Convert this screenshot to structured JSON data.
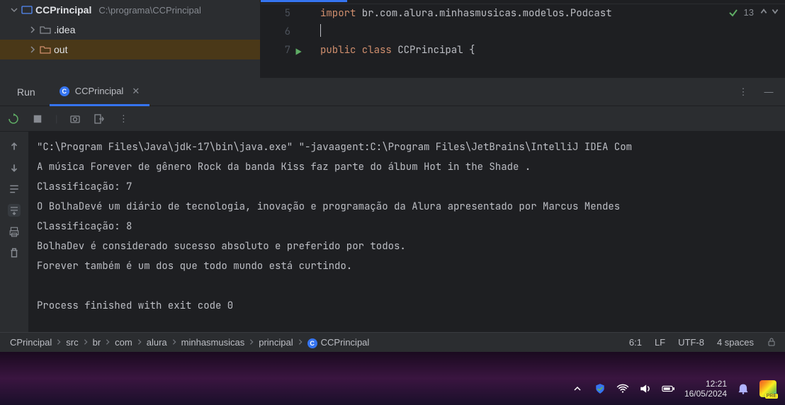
{
  "project_tree": {
    "root_name": "CCPrincipal",
    "root_path": "C:\\programa\\CCPrincipal",
    "items": [
      {
        "name": ".idea"
      },
      {
        "name": "out"
      }
    ]
  },
  "editor": {
    "lines": [
      {
        "num": "5",
        "keyword": "import",
        "rest": " br.com.alura.minhasmusicas.modelos.Podcast"
      },
      {
        "num": "6",
        "keyword": "",
        "rest": ""
      },
      {
        "num": "7",
        "keyword": "public",
        "mid": " class",
        "rest": " CCPrincipal {"
      }
    ],
    "problems_count": "13"
  },
  "run": {
    "label": "Run",
    "tab_name": "CCPrincipal",
    "console_lines": [
      "\"C:\\Program Files\\Java\\jdk-17\\bin\\java.exe\" \"-javaagent:C:\\Program Files\\JetBrains\\IntelliJ IDEA Com",
      "A música Forever de gênero Rock da banda Kiss faz parte do álbum Hot in the Shade .",
      "Classificação: 7",
      "O BolhaDevé um diário de tecnologia, inovação e programação da Alura apresentado por Marcus Mendes",
      "Classificação: 8",
      "BolhaDev é considerado sucesso absoluto e preferido por todos.",
      "Forever também é um dos que todo mundo está curtindo.",
      "",
      "Process finished with exit code 0"
    ]
  },
  "status_bar": {
    "breadcrumbs": [
      "CPrincipal",
      "src",
      "br",
      "com",
      "alura",
      "minhasmusicas",
      "principal",
      "CCPrincipal"
    ],
    "cursor": "6:1",
    "line_sep": "LF",
    "encoding": "UTF-8",
    "indent": "4 spaces"
  },
  "system": {
    "time": "12:21",
    "date": "16/05/2024"
  }
}
